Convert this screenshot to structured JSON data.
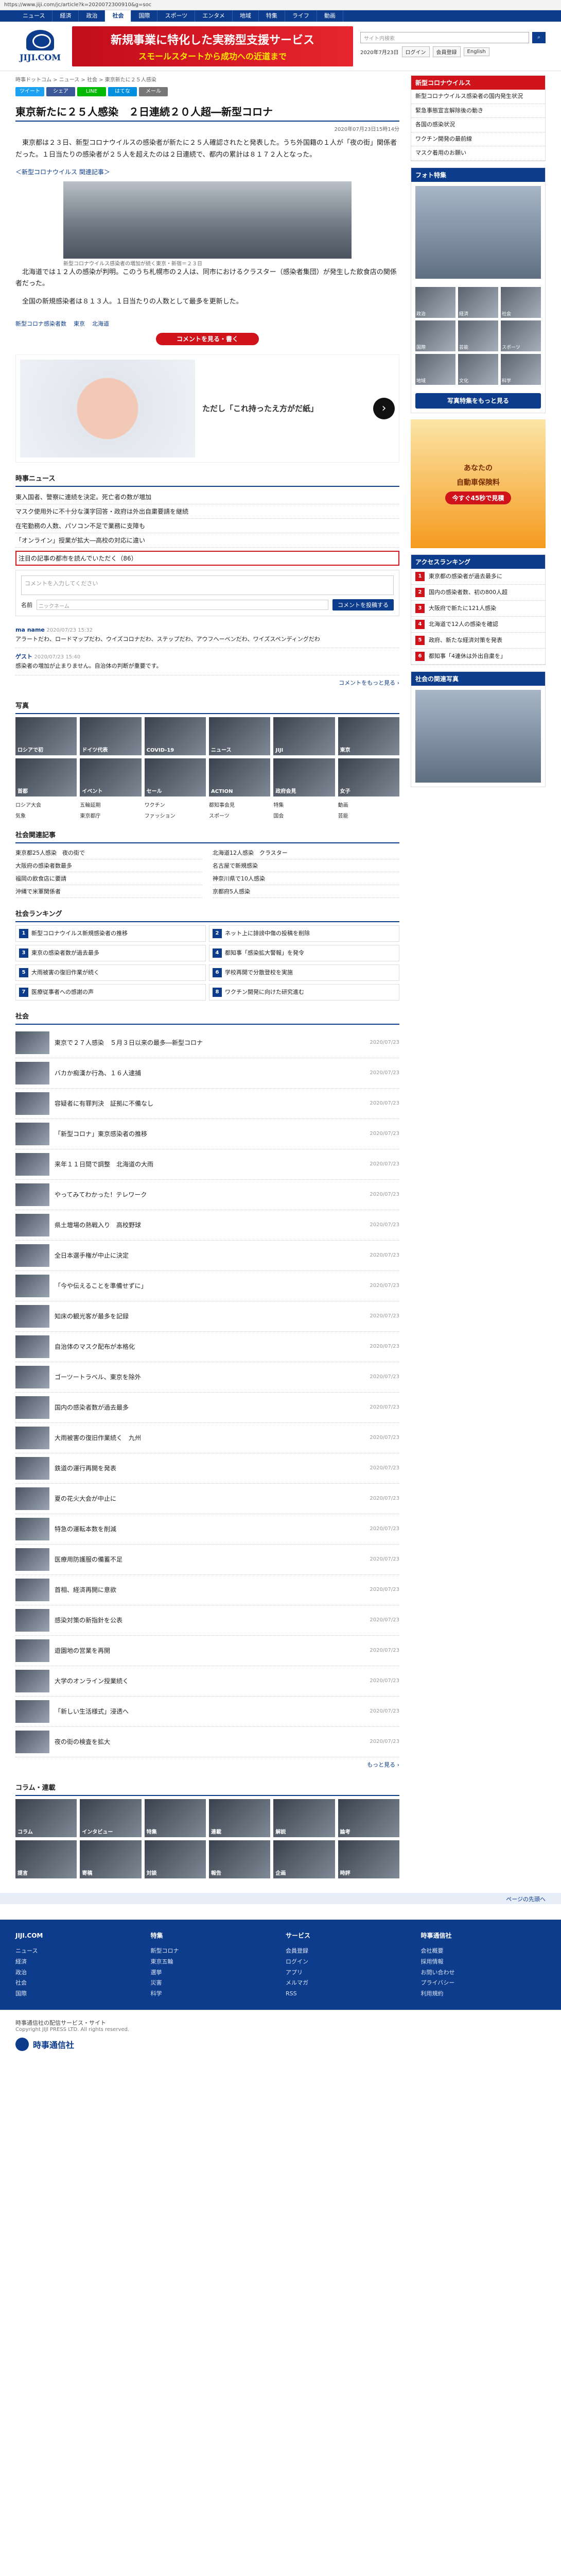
{
  "url": "https://www.jiji.com/jc/article?k=2020072300910&g=soc",
  "topnav": [
    "ニュース",
    "経済",
    "政治",
    "社会",
    "国際",
    "スポーツ",
    "エンタメ",
    "地域",
    "特集",
    "ライフ",
    "動画"
  ],
  "banner": {
    "line1": "新規事業に特化した実務型支援サービス",
    "line2": "スモールスタートから成功への近道まで"
  },
  "header": {
    "search_placeholder": "サイト内検索",
    "date": "2020年7月23日",
    "links": [
      "ログイン",
      "会員登録",
      "English"
    ]
  },
  "crumb": "時事ドットコム > ニュース > 社会 > 東京新たに２５人感染",
  "share": [
    {
      "label": "ツイート",
      "color": "#1da1f2"
    },
    {
      "label": "シェア",
      "color": "#3b5998"
    },
    {
      "label": "LINE",
      "color": "#00b900"
    },
    {
      "label": "はてな",
      "color": "#008fde"
    },
    {
      "label": "メール",
      "color": "#777777"
    }
  ],
  "article": {
    "title": "東京新たに２５人感染　２日連続２０人超―新型コロナ",
    "date": "2020年07月23日15時14分",
    "paragraphs": [
      "東京都は２３日、新型コロナウイルスの感染者が新たに２５人確認されたと発表した。うち外国籍の１人が「夜の街」関係者だった。１日当たりの感染者が２５人を超えたのは２日連続で、都内の累計は８１７２人となった。",
      "北海道では１２人の感染が判明。このうち札幌市の２人は、同市におけるクラスター（感染者集団）が発生した飲食店の関係者だった。",
      "全国の新規感染者は８１３人。１日当たりの人数として最多を更新した。"
    ],
    "related": "＜新型コロナウイルス 関連記事＞",
    "photo_caption": "新型コロナウイルス感染者の増加が続く東京・新宿＝２３日",
    "tags": [
      "新型コロナ感染者数",
      "東京",
      "北海道"
    ],
    "comment_button": "コメントを見る・書く"
  },
  "ad": {
    "text": "ただし「これ持ったえ方がだ紙」",
    "arrow": "›"
  },
  "news_section": {
    "title": "時事ニュース",
    "items": [
      "東入国者、警察に連続を決定。死亡者の数が増加",
      "マスク使用外に不十分な漢字回答・政府は外出自粛要請を継続",
      "在宅勤務の人数、パソコン不足で業務に支障も",
      "「オンライン」授業が拡大―高校の対応に違い"
    ],
    "highlight": "注目の記事の都市を読んでいただく（86）"
  },
  "comment": {
    "placeholder": "コメントを入力してください",
    "name_label": "名前",
    "name_placeholder": "ニックネーム",
    "post": "コメントを投稿する",
    "items": [
      {
        "user": "ma name",
        "time": "2020/07/23 15:32",
        "text": "アラートだわ、ロードマップだわ、ウイズコロナだわ、ステップだわ、アウフヘーベンだわ、ワイズスペンディングだわ"
      },
      {
        "user": "ゲスト",
        "time": "2020/07/23 15:40",
        "text": "感染者の増加が止まりません。自治体の判断が重要です。"
      }
    ],
    "more": "コメントをもっと見る ›"
  },
  "photo_section": {
    "title": "写真",
    "tiles": [
      "ロシアで初",
      "ドイツ代表",
      "COVID-19",
      "ニュース",
      "JIJI",
      "東京",
      "首都",
      "イベント",
      "セール",
      "ACTION",
      "政府会見",
      "女子"
    ],
    "captions": [
      "ロシア大会",
      "五輪延期",
      "ワクチン",
      "都知事会見",
      "特集",
      "動画",
      "気象",
      "東京都庁",
      "ファッション",
      "スポーツ",
      "国会",
      "芸能"
    ]
  },
  "related_section": {
    "title": "社会関連記事",
    "items": [
      "東京都25人感染　夜の街で",
      "北海道12人感染　クラスター",
      "大阪府の感染者数最多",
      "名古屋で新規感染",
      "福岡の飲食店に要請",
      "神奈川県で10人感染",
      "沖縄で米軍関係者",
      "京都府5人感染"
    ]
  },
  "ranking_grid": {
    "title": "社会ランキング",
    "items": [
      {
        "no": "1",
        "text": "新型コロナウイルス新規感染者の推移"
      },
      {
        "no": "2",
        "text": "ネット上に誹謗中傷の投稿を削除"
      },
      {
        "no": "3",
        "text": "東京の感染者数が過去最多"
      },
      {
        "no": "4",
        "text": "都知事「感染拡大警報」を発令"
      },
      {
        "no": "5",
        "text": "大雨被害の復旧作業が続く"
      },
      {
        "no": "6",
        "text": "学校再開で分散登校を実施"
      },
      {
        "no": "7",
        "text": "医療従事者への感謝の声"
      },
      {
        "no": "8",
        "text": "ワクチン開発に向けた研究進む"
      }
    ]
  },
  "video_section": {
    "title": "社会",
    "items": [
      {
        "text": "東京で２７人感染　５月３日以来の最多―新型コロナ",
        "time": "2020/07/23"
      },
      {
        "text": "バカか痴漢か行為、１６人逮捕",
        "time": "2020/07/23"
      },
      {
        "text": "容疑者に有罪判決　証拠に不備なし",
        "time": "2020/07/23"
      },
      {
        "text": "「新型コロナ」東京感染者の推移",
        "time": "2020/07/23"
      },
      {
        "text": "来年１１日間で調整　北海道の大雨",
        "time": "2020/07/23"
      },
      {
        "text": "やってみてわかった！テレワーク",
        "time": "2020/07/23"
      },
      {
        "text": "県土壇場の熱戦入り　高校野球",
        "time": "2020/07/23"
      },
      {
        "text": "全日本選手権が中止に決定",
        "time": "2020/07/23"
      },
      {
        "text": "「今や伝えることを準備せずに」",
        "time": "2020/07/23"
      },
      {
        "text": "知床の観光客が最多を記録",
        "time": "2020/07/23"
      },
      {
        "text": "自治体のマスク配布が本格化",
        "time": "2020/07/23"
      },
      {
        "text": "ゴーツートラベル、東京を除外",
        "time": "2020/07/23"
      },
      {
        "text": "国内の感染者数が過去最多",
        "time": "2020/07/23"
      },
      {
        "text": "大雨被害の復旧作業続く　九州",
        "time": "2020/07/23"
      },
      {
        "text": "鉄道の運行再開を発表",
        "time": "2020/07/23"
      },
      {
        "text": "夏の花火大会が中止に",
        "time": "2020/07/23"
      },
      {
        "text": "特急の運転本数を削減",
        "time": "2020/07/23"
      },
      {
        "text": "医療用防護服の備蓄不足",
        "time": "2020/07/23"
      },
      {
        "text": "首相、経済再開に意欲",
        "time": "2020/07/23"
      },
      {
        "text": "感染対策の新指針を公表",
        "time": "2020/07/23"
      },
      {
        "text": "遊園地の営業を再開",
        "time": "2020/07/23"
      },
      {
        "text": "大学のオンライン授業続く",
        "time": "2020/07/23"
      },
      {
        "text": "「新しい生活様式」浸透へ",
        "time": "2020/07/23"
      },
      {
        "text": "夜の街の検査を拡大",
        "time": "2020/07/23"
      }
    ],
    "more": "もっと見る ›"
  },
  "column_section": {
    "title": "コラム・連載",
    "tiles": [
      "コラム",
      "インタビュー",
      "特集",
      "連載",
      "解説",
      "論考",
      "提言",
      "寄稿",
      "対談",
      "報告",
      "企画",
      "時評"
    ]
  },
  "side": {
    "corona_title": "新型コロナウイルス",
    "corona_items": [
      "新型コロナウイルス感染者の国内発生状況",
      "緊急事態宣言解除後の動き",
      "各国の感染状況",
      "ワクチン開発の最前線",
      "マスク着用のお願い"
    ],
    "photo_title": "フォト特集",
    "photo_tiles": [
      "政治",
      "経済",
      "社会",
      "国際",
      "芸能",
      "スポーツ",
      "地域",
      "文化",
      "科学"
    ],
    "photo_button": "写真特集をもっと見る",
    "ad_line1": "あなたの",
    "ad_line2": "自動車保険料",
    "ad_cta": "今すぐ45秒で見積",
    "rank_title": "アクセスランキング",
    "rank_items": [
      {
        "no": "1",
        "text": "東京都の感染者が過去最多に"
      },
      {
        "no": "2",
        "text": "国内の感染者数、初の800人超"
      },
      {
        "no": "3",
        "text": "大阪府で新たに121人感染"
      },
      {
        "no": "4",
        "text": "北海道で12人の感染を確認"
      },
      {
        "no": "5",
        "text": "政府、新たな経済対策を発表"
      },
      {
        "no": "6",
        "text": "都知事「4連休は外出自粛を」"
      }
    ],
    "reader_title": "社会の関連写真"
  },
  "footer": {
    "top": "ページの先頭へ",
    "cols": [
      {
        "title": "JIJI.COM",
        "items": [
          "ニュース",
          "経済",
          "政治",
          "社会",
          "国際"
        ]
      },
      {
        "title": "特集",
        "items": [
          "新型コロナ",
          "東京五輪",
          "選挙",
          "災害",
          "科学"
        ]
      },
      {
        "title": "サービス",
        "items": [
          "会員登録",
          "ログイン",
          "アプリ",
          "メルマガ",
          "RSS"
        ]
      },
      {
        "title": "時事通信社",
        "items": [
          "会社概要",
          "採用情報",
          "お問い合わせ",
          "プライバシー",
          "利用規約"
        ]
      }
    ],
    "bottom": "時事通信社の配信サービス・サイト",
    "copyright": "Copyright JIJI PRESS LTD. All rights reserved.",
    "logo": "時事通信社"
  }
}
